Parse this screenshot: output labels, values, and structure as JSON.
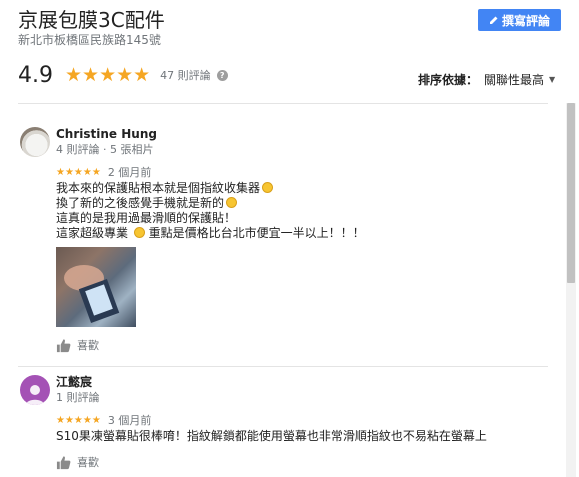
{
  "business": {
    "name": "京展包膜3C配件",
    "address": "新北市板橋區民族路145號"
  },
  "write_review_label": "撰寫評論",
  "summary": {
    "rating": "4.9",
    "stars": "★★★★★",
    "review_count": "47 則評論",
    "info_icon": "?"
  },
  "sort": {
    "label": "排序依據：",
    "value": "關聯性最高"
  },
  "reviews": [
    {
      "name": "Christine Hung",
      "meta": "4 則評論 · 5 張相片",
      "stars": "★★★★★",
      "time": "2 個月前",
      "lines": [
        "我本來的保護貼根本就是個指紋收集器",
        "換了新的之後感覺手機就是新的",
        "這真的是我用過最滑順的保護貼！",
        "這家超級專業",
        "重點是價格比台北市便宜一半以上！！！"
      ],
      "like_label": "喜歡"
    },
    {
      "name": "江懿宸",
      "meta": "1 則評論",
      "stars": "★★★★★",
      "time": "3 個月前",
      "lines": [
        "S10果凍螢幕貼很棒唷！指紋解鎖都能使用螢幕也非常滑順指紋也不易粘在螢幕上"
      ],
      "like_label": "喜歡"
    }
  ],
  "colors": {
    "accent": "#4285f4",
    "star": "#f5a623",
    "avatar_purple": "#a452b5"
  }
}
